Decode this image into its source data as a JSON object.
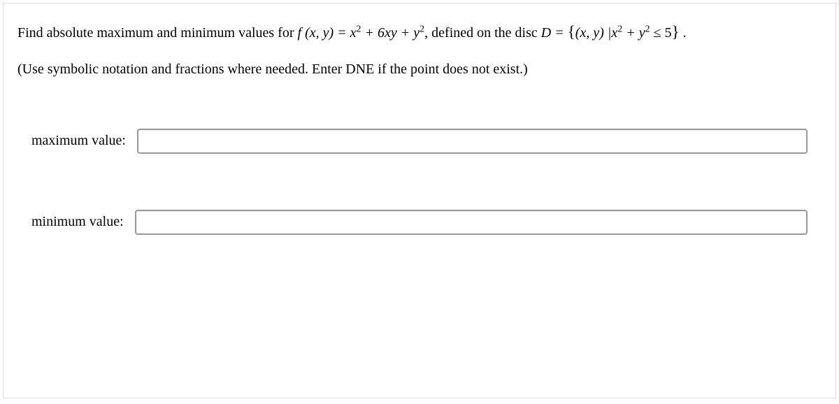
{
  "question_prefix": "Find absolute maximum and minimum values for ",
  "func_head": "f (x, y) = x",
  "func_mid": " + 6xy + y",
  "func_tail": ", defined on the disc ",
  "disc_head": "D = ",
  "set_open": "{",
  "set_body": "(x, y) |x",
  "set_mid": " + y",
  "set_tail": " ≤ 5",
  "set_close": "}",
  "period": " .",
  "sup2": "2",
  "instruction": "(Use symbolic notation and fractions where needed. Enter DNE if the point does not exist.)",
  "labels": {
    "max": "maximum value:",
    "min": "minimum value:"
  },
  "values": {
    "max": "",
    "min": ""
  }
}
